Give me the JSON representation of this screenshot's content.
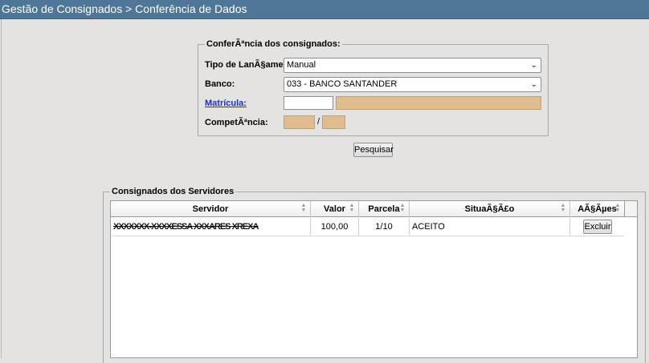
{
  "title": "Gestão de Consignados > Conferência de Dados",
  "search": {
    "legend": "ConferÃªncia dos consignados:",
    "tipo_label": "Tipo de LanÃ§amento:",
    "tipo_value": "Manual",
    "banco_label": "Banco:",
    "banco_value": "033 - BANCO SANTANDER",
    "matricula_label": "Matrícula:",
    "competencia_label": "CompetÃªncia:",
    "competencia_sep": "/",
    "button_label": "Pesquisar"
  },
  "results": {
    "legend": "Consignados dos Servidores",
    "columns": [
      "Servidor",
      "Valor",
      "Parcela",
      "SituaÃ§Ã£o",
      "AÃ§Ãµes"
    ],
    "rows": [
      {
        "servidor": "XXXXXXX-XXXXESSA XXXARES XREXA",
        "valor": "100,00",
        "parcela": "1/10",
        "situacao": "ACEITO",
        "acao": "Excluir"
      }
    ]
  },
  "icons": {
    "sort": "sort-arrows-icon",
    "dropdown": "chevron-down-icon"
  },
  "colors": {
    "titlebar": "#4f7696",
    "readonly_field": "#e1bc8e",
    "link": "#1a31c8"
  }
}
